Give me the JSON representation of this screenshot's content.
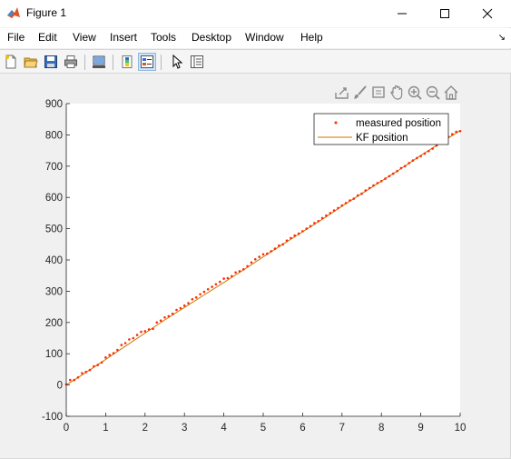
{
  "window": {
    "title": "Figure 1"
  },
  "menu": {
    "items": [
      "File",
      "Edit",
      "View",
      "Insert",
      "Tools",
      "Desktop",
      "Window",
      "Help"
    ]
  },
  "toolbar": {
    "icons": [
      "new-figure-icon",
      "open-file-icon",
      "save-icon",
      "print-icon",
      "link-plot-icon",
      "colorbar-icon",
      "legend-icon",
      "edit-plot-icon",
      "property-inspector-icon"
    ]
  },
  "axes_toolbar": {
    "icons": [
      "export-icon",
      "brush-icon",
      "data-tips-icon",
      "pan-icon",
      "zoom-in-icon",
      "zoom-out-icon",
      "home-icon"
    ]
  },
  "colors": {
    "measured": "#ff2a00",
    "kf": "#c87500",
    "axes_bg": "#ffffff",
    "figure_bg": "#f0f0f0"
  },
  "chart_data": {
    "type": "line",
    "title": "",
    "xlabel": "",
    "ylabel": "",
    "xlim": [
      0,
      10
    ],
    "ylim": [
      -100,
      900
    ],
    "xticks": [
      "0",
      "1",
      "2",
      "3",
      "4",
      "5",
      "6",
      "7",
      "8",
      "9",
      "10"
    ],
    "yticks": [
      "-100",
      "0",
      "100",
      "200",
      "300",
      "400",
      "500",
      "600",
      "700",
      "800",
      "900"
    ],
    "legend_position": "top-right",
    "series": [
      {
        "name": "measured position",
        "style": "points",
        "color": "#ff2a00",
        "x": [
          0,
          0.1,
          0.2,
          0.3,
          0.4,
          0.5,
          0.6,
          0.7,
          0.8,
          0.9,
          1.0,
          1.1,
          1.2,
          1.3,
          1.4,
          1.5,
          1.6,
          1.7,
          1.8,
          1.9,
          2.0,
          2.1,
          2.2,
          2.3,
          2.4,
          2.5,
          2.6,
          2.7,
          2.8,
          2.9,
          3.0,
          3.1,
          3.2,
          3.3,
          3.4,
          3.5,
          3.6,
          3.7,
          3.8,
          3.9,
          4.0,
          4.1,
          4.2,
          4.3,
          4.4,
          4.5,
          4.6,
          4.7,
          4.8,
          4.9,
          5.0,
          5.1,
          5.2,
          5.3,
          5.4,
          5.5,
          5.6,
          5.7,
          5.8,
          5.9,
          6.0,
          6.1,
          6.2,
          6.3,
          6.4,
          6.5,
          6.6,
          6.7,
          6.8,
          6.9,
          7.0,
          7.1,
          7.2,
          7.3,
          7.4,
          7.5,
          7.6,
          7.7,
          7.8,
          7.9,
          8.0,
          8.1,
          8.2,
          8.3,
          8.4,
          8.5,
          8.6,
          8.7,
          8.8,
          8.9,
          9.0,
          9.1,
          9.2,
          9.3,
          9.4,
          9.5,
          9.6,
          9.7,
          9.8,
          9.9,
          10.0
        ],
        "y": [
          2,
          16,
          16,
          24,
          38,
          42,
          48,
          60,
          64,
          72,
          88,
          96,
          102,
          112,
          128,
          134,
          146,
          150,
          160,
          170,
          172,
          178,
          180,
          200,
          206,
          216,
          220,
          228,
          240,
          246,
          254,
          262,
          274,
          280,
          290,
          298,
          306,
          314,
          322,
          330,
          340,
          342,
          348,
          360,
          364,
          370,
          380,
          392,
          402,
          410,
          418,
          420,
          428,
          436,
          446,
          450,
          462,
          470,
          478,
          484,
          492,
          500,
          508,
          518,
          524,
          534,
          542,
          550,
          558,
          566,
          574,
          582,
          590,
          596,
          606,
          612,
          622,
          630,
          638,
          646,
          652,
          660,
          668,
          676,
          684,
          694,
          700,
          710,
          718,
          726,
          732,
          740,
          748,
          756,
          766,
          776,
          784,
          794,
          802,
          810,
          812
        ]
      },
      {
        "name": "KF position",
        "style": "line",
        "color": "#c87500",
        "x": [
          0,
          0.5,
          1,
          1.5,
          2,
          2.5,
          3,
          3.5,
          4,
          4.5,
          5,
          5.5,
          6,
          6.5,
          7,
          7.5,
          8,
          8.5,
          9,
          9.5,
          10
        ],
        "y": [
          0,
          40,
          82,
          124,
          166,
          208,
          248,
          288,
          328,
          368,
          410,
          450,
          490,
          530,
          572,
          612,
          652,
          692,
          734,
          774,
          814
        ]
      }
    ]
  }
}
